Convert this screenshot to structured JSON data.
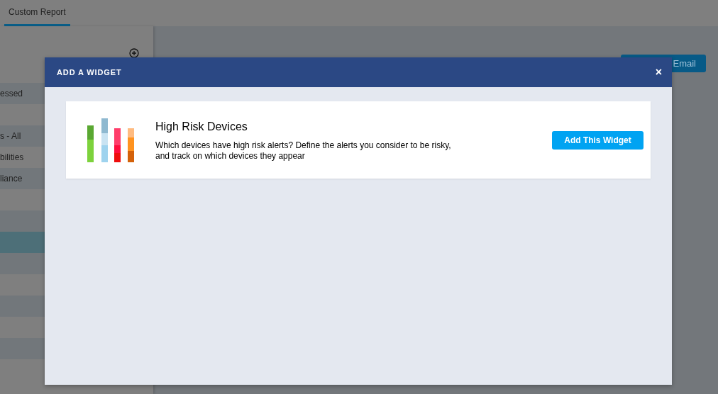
{
  "tabs": [
    {
      "label": "Custom Report",
      "selected": true
    }
  ],
  "sidebar": {
    "items": [
      {
        "label": "essed",
        "selected": false
      },
      {
        "selected": false
      },
      {
        "label": "s - All",
        "selected": false
      },
      {
        "label": "bilities",
        "selected": false
      },
      {
        "label": "liance",
        "selected": false
      },
      {
        "selected": false
      },
      {
        "selected": false
      },
      {
        "selected": true
      },
      {
        "selected": false
      },
      {
        "selected": false
      },
      {
        "selected": false
      },
      {
        "selected": false
      },
      {
        "selected": false
      },
      {
        "selected": false
      }
    ]
  },
  "header_button": {
    "label": "Email"
  },
  "modal": {
    "title": "ADD A WIDGET",
    "close": "×",
    "widgets": [
      {
        "title": "High Risk Devices",
        "description": "Which devices have high risk alerts? Define the alerts you consider to be risky, and track on which devices they appear",
        "button": "Add This Widget"
      }
    ]
  }
}
